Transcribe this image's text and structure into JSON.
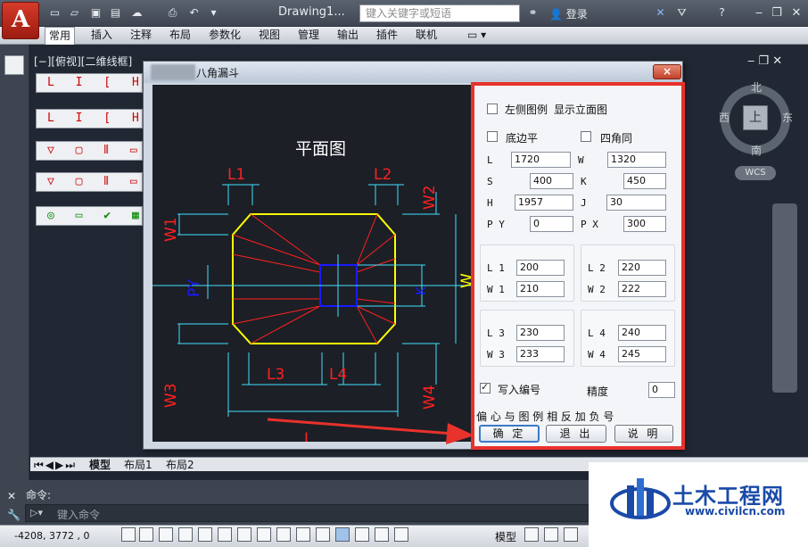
{
  "app": {
    "logo_letter": "A",
    "doc_title": "Drawing1...",
    "search_placeholder": "键入关键字或短语",
    "login_label": "登录"
  },
  "quick_access": [
    "new-icon",
    "open-icon",
    "save-icon",
    "saveas-icon",
    "cloud-icon",
    "print-icon",
    "undo-icon"
  ],
  "ribbon_tabs": [
    "常用",
    "插入",
    "注释",
    "布局",
    "参数化",
    "视图",
    "管理",
    "输出",
    "插件",
    "联机"
  ],
  "active_tab": "常用",
  "viewport": {
    "view_label": "[−][俯视][二维线框]",
    "compass": {
      "north": "北",
      "south": "南",
      "east": "东",
      "west": "西",
      "top_face": "上"
    },
    "wcs": "WCS"
  },
  "left_toolbars": {
    "row1": "L I [ H O",
    "row2": "L I [ H O"
  },
  "dialog": {
    "title": "八角漏斗",
    "close_label": "×",
    "preview": {
      "title": "平面图",
      "labels": {
        "L1": "L1",
        "L2": "L2",
        "L3": "L3",
        "L4": "L4",
        "W1": "W1",
        "W2": "W2",
        "W3": "W3",
        "W4": "W4",
        "L": "L",
        "W": "W",
        "PY": "PY",
        "K": "K"
      }
    },
    "options": {
      "left_legend": "左侧图例",
      "show_elevation": "显示立面图",
      "bottom_flat": "底边平",
      "four_corner_same": "四角同"
    },
    "params": {
      "L_label": "L",
      "L_value": "1720",
      "W_label": "W",
      "W_value": "1320",
      "S_label": "S",
      "S_value": "400",
      "K_label": "K",
      "K_value": "450",
      "H_label": "H",
      "H_value": "1957",
      "J_label": "J",
      "J_value": "30",
      "PY_label": "P Y",
      "PY_value": "0",
      "PX_label": "P X",
      "PX_value": "300"
    },
    "corners": {
      "L1_label": "L 1",
      "L1_value": "200",
      "W1_label": "W 1",
      "W1_value": "210",
      "L2_label": "L 2",
      "L2_value": "220",
      "W2_label": "W 2",
      "W2_value": "222",
      "L3_label": "L 3",
      "L3_value": "230",
      "W3_label": "W 3",
      "W3_value": "233",
      "L4_label": "L 4",
      "L4_value": "240",
      "W4_label": "W 4",
      "W4_value": "245"
    },
    "write_number_label": "写入编号",
    "write_number_checked": true,
    "precision_label": "精度",
    "precision_value": "0",
    "note": "偏 心 与 图 例 相 反 加 负 号",
    "buttons": {
      "ok": "确 定",
      "exit": "退 出",
      "help": "说 明"
    }
  },
  "layout_tabs": [
    "模型",
    "布局1",
    "布局2"
  ],
  "command": {
    "label": "命令:",
    "placeholder": "键入命令"
  },
  "status": {
    "coords": "-4208, 3772 , 0",
    "model_label": "模型"
  },
  "watermark": {
    "title": "土木工程网",
    "url": "www.civilcn.com"
  },
  "colors": {
    "highlight_frame": "#e8322c",
    "arrow": "#e8322c",
    "drawing_yellow": "#ffff00",
    "drawing_red": "#ff2020",
    "drawing_cyan": "#40e0ff",
    "drawing_blue": "#1a1aff"
  }
}
